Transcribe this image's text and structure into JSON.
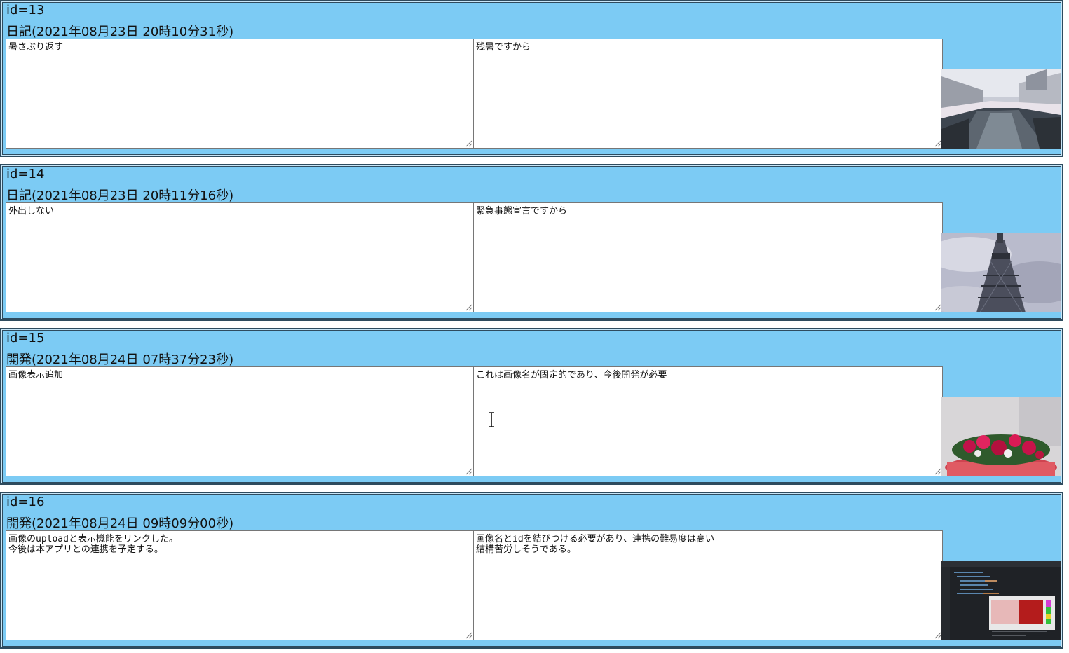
{
  "entries": [
    {
      "id_label": "id=13",
      "category": "日記",
      "timestamp": "(2021年08月23日 20時10分31秒)",
      "left_text": "暑さぶり返す",
      "right_text": "残暑ですから",
      "image": "river-photo"
    },
    {
      "id_label": "id=14",
      "category": "日記",
      "timestamp": "(2021年08月23日 20時11分16秒)",
      "left_text": "外出しない",
      "right_text": "緊急事態宣言ですから",
      "image": "tower-photo"
    },
    {
      "id_label": "id=15",
      "category": "開発",
      "timestamp": "(2021年08月24日 07時37分23秒)",
      "left_text": "画像表示追加",
      "right_text": "これは画像名が固定的であり、今後開発が必要",
      "image": "flowers-photo"
    },
    {
      "id_label": "id=16",
      "category": "開発",
      "timestamp": "(2021年08月24日 09時09分00秒)",
      "left_text": "画像のuploadと表示機能をリンクした。\n今後は本アプリとの連携を予定する。",
      "right_text": "画像名とidを結びつける必要があり、連携の難易度は高い\n結構苦労しそうである。",
      "image": "editor-screenshot"
    }
  ],
  "colors": {
    "panel_bg": "#7ccbf4",
    "panel_border": "#2e4b5e"
  }
}
